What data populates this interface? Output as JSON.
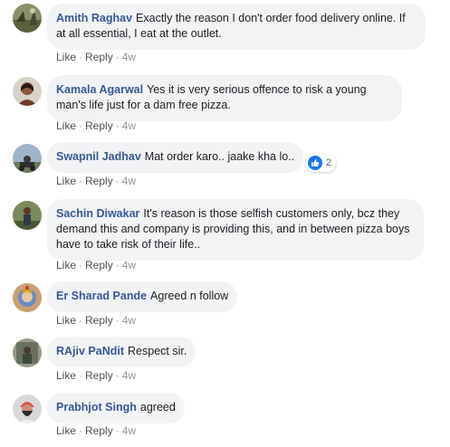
{
  "actions": {
    "like": "Like",
    "reply": "Reply",
    "sep": "·"
  },
  "colors": {
    "author": "#385898",
    "bubble": "#f2f3f5",
    "like": "#1877f2"
  },
  "comments": [
    {
      "author": "Amith Raghav",
      "text": "Exactly the reason I don't order food delivery online. If at all essential, I eat at the outlet.",
      "time": "4w"
    },
    {
      "author": "Kamala Agarwal",
      "text": "Yes it is very serious offence to risk a young man's life just for a dam free pizza.",
      "time": "4w"
    },
    {
      "author": "Swapnil Jadhav",
      "text": "Mat order karo.. jaake kha lo..",
      "time": "4w",
      "reactions": {
        "icon": "thumbs-up-icon",
        "count": "2"
      }
    },
    {
      "author": "Sachin Diwakar",
      "text": "It's reason is those selfish customers only, bcz they demand this and company is providing this, and in between pizza boys have to take risk of their life..",
      "time": "4w"
    },
    {
      "author": "Er Sharad Pande",
      "text": "Agreed n follow",
      "time": "4w"
    },
    {
      "author": "RAjiv PaNdit",
      "text": "Respect sir.",
      "time": "4w"
    },
    {
      "author": "Prabhjot Singh",
      "text": "agreed",
      "time": "4w"
    }
  ]
}
